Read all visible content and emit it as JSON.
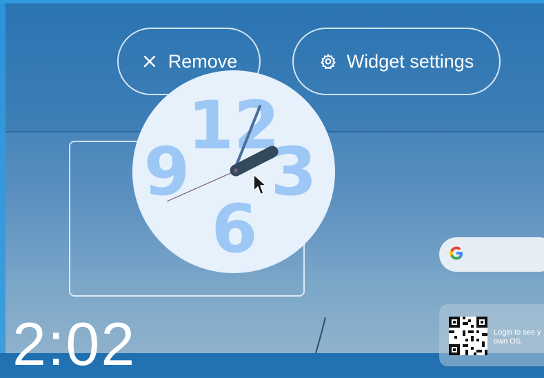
{
  "toolbar": {
    "remove_label": "Remove",
    "settings_label": "Widget settings"
  },
  "clock": {
    "numerals": [
      "12",
      "3",
      "6",
      "9"
    ],
    "face_color": "#e7f1fb",
    "numeral_color": "#9dc8f5",
    "hand_color": "#34495e",
    "minute_hand_color": "#4a6f9a",
    "second_hand_color": "#7a5a7a"
  },
  "search": {
    "logo_letter": "G"
  },
  "qr_card": {
    "text": "Login to see y\nown OS."
  },
  "wallpaper": {
    "time_fragment": "2:02"
  },
  "colors": {
    "accent_border": "#2f9ae0"
  }
}
